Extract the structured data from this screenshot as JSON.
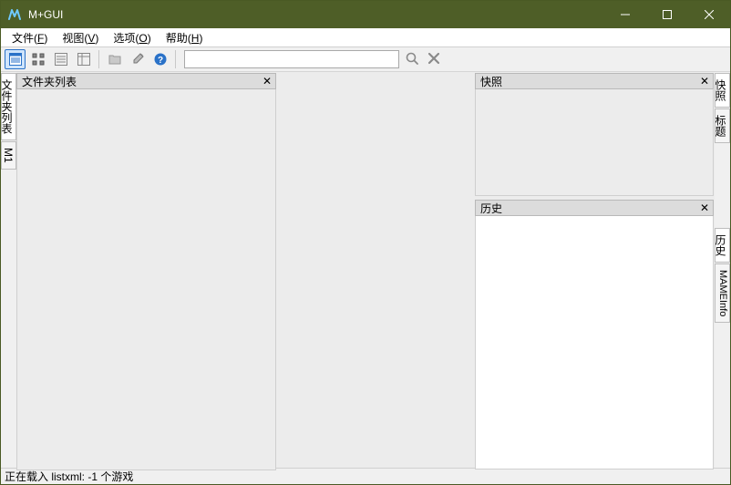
{
  "window": {
    "title": "M+GUI"
  },
  "menu": {
    "file": {
      "label": "文件",
      "hotkey": "F",
      "full": "文件(F)"
    },
    "view": {
      "label": "视图",
      "hotkey": "V",
      "full": "视图(V)"
    },
    "options": {
      "label": "选项",
      "hotkey": "O",
      "full": "选项(O)"
    },
    "help": {
      "label": "帮助",
      "hotkey": "H",
      "full": "帮助(H)"
    }
  },
  "toolbar": {
    "view_large_icons": "大图标",
    "view_small_icons": "小图标",
    "view_list": "列表",
    "view_details": "详情",
    "open_folder": "打开文件夹",
    "settings": "设置",
    "about": "关于"
  },
  "search": {
    "placeholder": "",
    "value": ""
  },
  "left_tabs": {
    "folder_list": "文件夹列表",
    "m1": "M1"
  },
  "right_tabs": {
    "snapshot": "快照",
    "title": "标题",
    "history": "历史",
    "mameinfo": "MAMEInfo"
  },
  "panels": {
    "folder_list": {
      "title": "文件夹列表"
    },
    "snapshot": {
      "title": "快照"
    },
    "history": {
      "title": "历史"
    }
  },
  "status": {
    "text": "正在载入 listxml: -1 个游戏"
  }
}
